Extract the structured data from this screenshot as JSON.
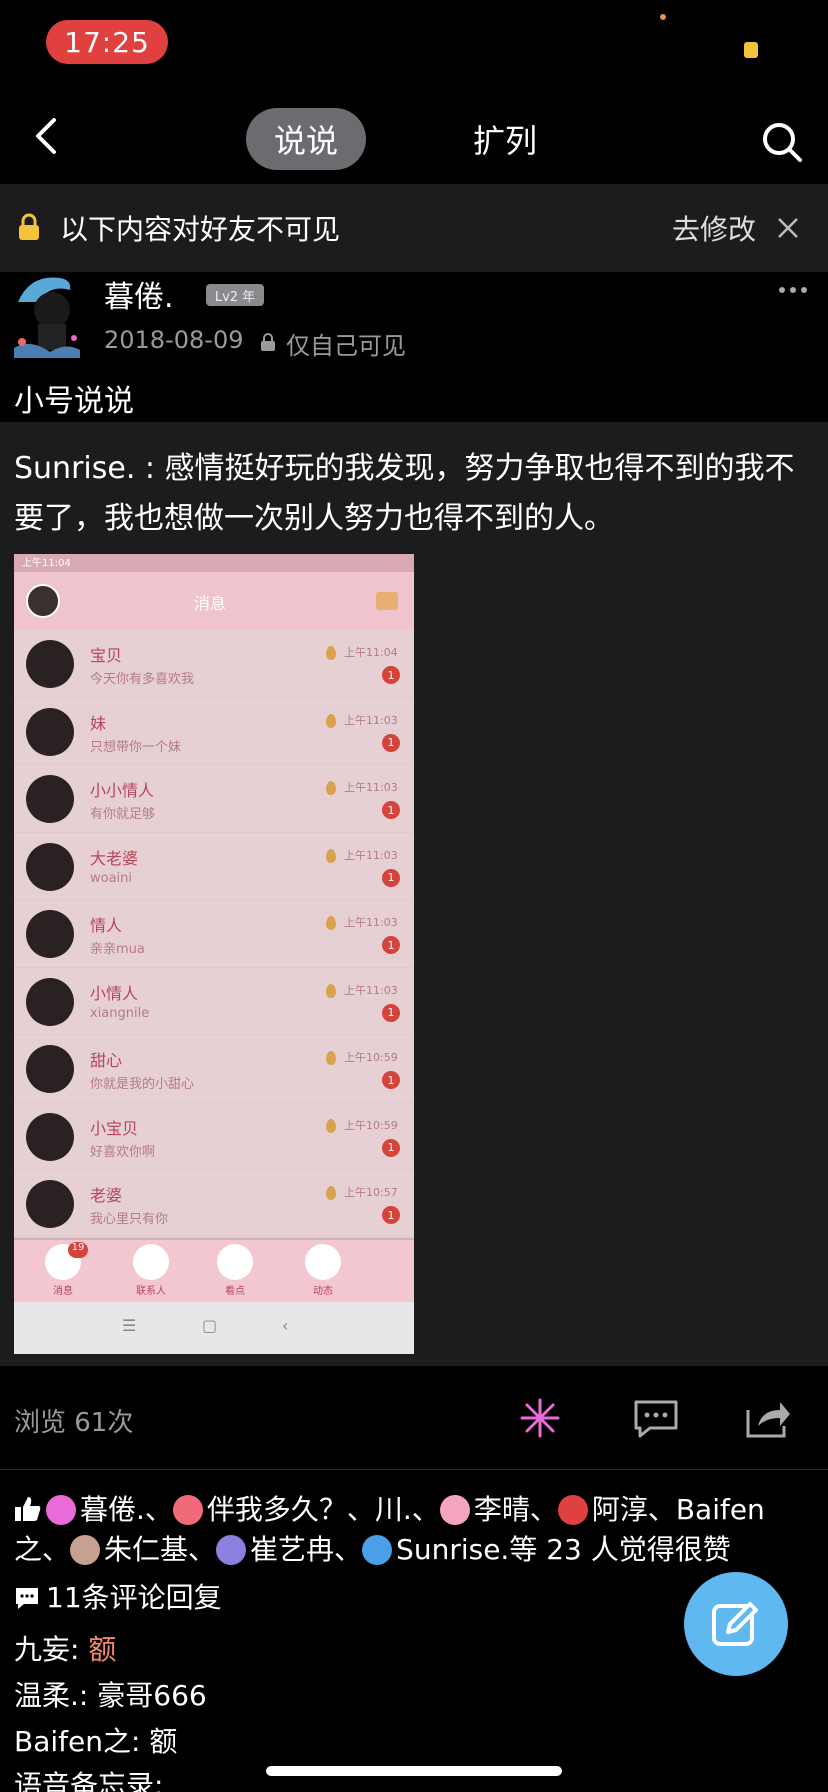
{
  "status_bar": {
    "time": "17:25"
  },
  "nav": {
    "tab_active": "说说",
    "tab_inactive": "扩列"
  },
  "notice": {
    "text": "以下内容对好友不可见",
    "action": "去修改"
  },
  "post": {
    "username": "暮倦.",
    "level": "Lv2 年",
    "date": "2018-08-09",
    "privacy": "仅自己可见",
    "title": "小号说说",
    "quote": "Sunrise. : 感情挺好玩的我发现，努力争取也得不到的我不要了，我也想做一次别人努力也得不到的人。"
  },
  "embed": {
    "status": "上午11:04",
    "title": "消息",
    "messages": [
      {
        "name": "宝贝",
        "preview": "今天你有多喜欢我",
        "time": "上午11:04",
        "badge": "1"
      },
      {
        "name": "妹",
        "preview": "只想带你一个妹",
        "time": "上午11:03",
        "badge": "1"
      },
      {
        "name": "小小情人",
        "preview": "有你就足够",
        "time": "上午11:03",
        "badge": "1"
      },
      {
        "name": "大老婆",
        "preview": "woaini",
        "time": "上午11:03",
        "badge": "1"
      },
      {
        "name": "情人",
        "preview": "亲亲mua",
        "time": "上午11:03",
        "badge": "1"
      },
      {
        "name": "小情人",
        "preview": "xiangnile",
        "time": "上午11:03",
        "badge": "1"
      },
      {
        "name": "甜心",
        "preview": "你就是我的小甜心",
        "time": "上午10:59",
        "badge": "1"
      },
      {
        "name": "小宝贝",
        "preview": "好喜欢你啊",
        "time": "上午10:59",
        "badge": "1"
      },
      {
        "name": "老婆",
        "preview": "我心里只有你",
        "time": "上午10:57",
        "badge": "1"
      }
    ],
    "tabs": [
      {
        "label": "消息",
        "badge": "19"
      },
      {
        "label": "联系人"
      },
      {
        "label": "看点"
      },
      {
        "label": "动态"
      }
    ],
    "sysnav": [
      "☰",
      "▢",
      "‹"
    ]
  },
  "stats": {
    "views": "浏览 61次"
  },
  "likes": {
    "names": [
      "暮倦.、",
      "伴我多久？、川.、",
      "李晴、",
      "阿淳、Baifen之、",
      "朱仁基、",
      "崔艺冉、",
      "Sunrise.等 23 人觉得很赞"
    ]
  },
  "comments": {
    "count": "11条评论回复",
    "items": [
      {
        "author": "九妄: ",
        "text": "额",
        "red": true
      },
      {
        "author": "温柔.: ",
        "text": "豪哥666",
        "red": false
      },
      {
        "author": "Baifen之: ",
        "text": "额",
        "red": false
      },
      {
        "author": "语音备忘录:",
        "text": "",
        "red": false
      }
    ]
  },
  "colors": {
    "accent_blue": "#5fb8ef",
    "time_pill": "#e0413f",
    "embed_pink": "#f0c4cc"
  }
}
